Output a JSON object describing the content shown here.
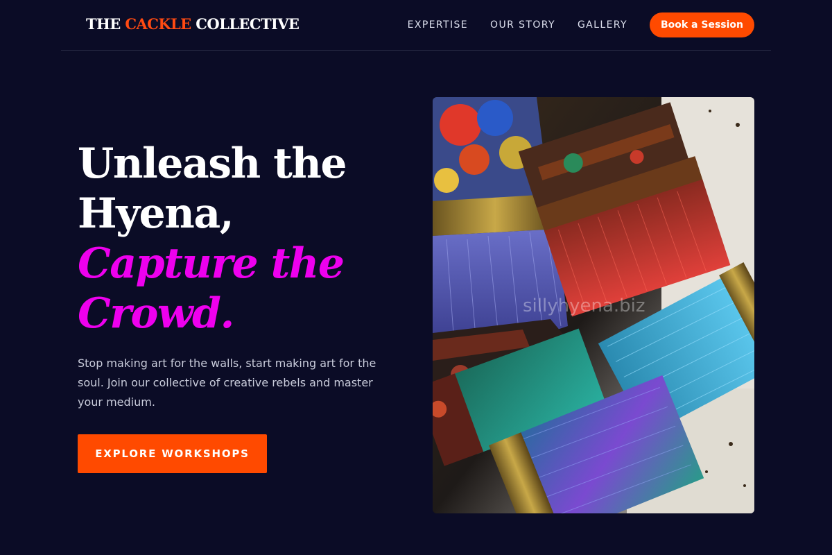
{
  "header": {
    "logo": {
      "part1": "THE",
      "accent": "CACKLE",
      "part2": "COLLECTIVE"
    },
    "nav": [
      {
        "label": "EXPERTISE"
      },
      {
        "label": "OUR STORY"
      },
      {
        "label": "GALLERY"
      }
    ],
    "cta_label": "Book a Session"
  },
  "hero": {
    "title_line1": "Unleash the",
    "title_line2": "Hyena,",
    "title_em_line1": "Capture the",
    "title_em_line2": "Crowd.",
    "subtitle": "Stop making art for the walls, start making art for the soul. Join our collective of creative rebels and master your medium.",
    "cta_label": "EXPLORE WORKSHOPS",
    "image_watermark": "sillyhyena.biz"
  },
  "colors": {
    "background": "#0b0c26",
    "accent_orange": "#ff4a00",
    "accent_magenta": "#ee00ee",
    "text_muted": "#c9ccdb"
  }
}
